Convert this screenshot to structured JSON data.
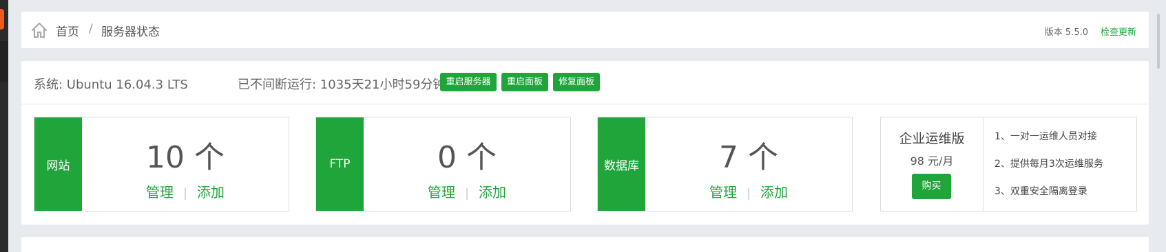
{
  "colors": {
    "accent": "#20a53a",
    "background": "#e7eaee"
  },
  "breadcrumb": {
    "home_icon": "home-icon",
    "home": "首页",
    "separator": "/",
    "current": "服务器状态",
    "version": "版本 5.5.0",
    "update": "检查更新"
  },
  "system": {
    "os": "系统: Ubuntu 16.04.3 LTS",
    "uptime": "已不间断运行: 1035天21小时59分钟",
    "buttons": [
      "重启服务器",
      "重启面板",
      "修复面板"
    ]
  },
  "stats": [
    {
      "tag": "网站",
      "count": "10 个",
      "manage": "管理",
      "sep": "|",
      "add": "添加"
    },
    {
      "tag": "FTP",
      "count": "0 个",
      "manage": "管理",
      "sep": "|",
      "add": "添加"
    },
    {
      "tag": "数据库",
      "count": "7 个",
      "manage": "管理",
      "sep": "|",
      "add": "添加"
    }
  ],
  "promo": {
    "title": "企业运维版",
    "price": "98 元/月",
    "buy": "购买",
    "features": [
      "1、一对一运维人员对接",
      "2、提供每月3次运维服务",
      "3、双重安全隔离登录"
    ]
  }
}
